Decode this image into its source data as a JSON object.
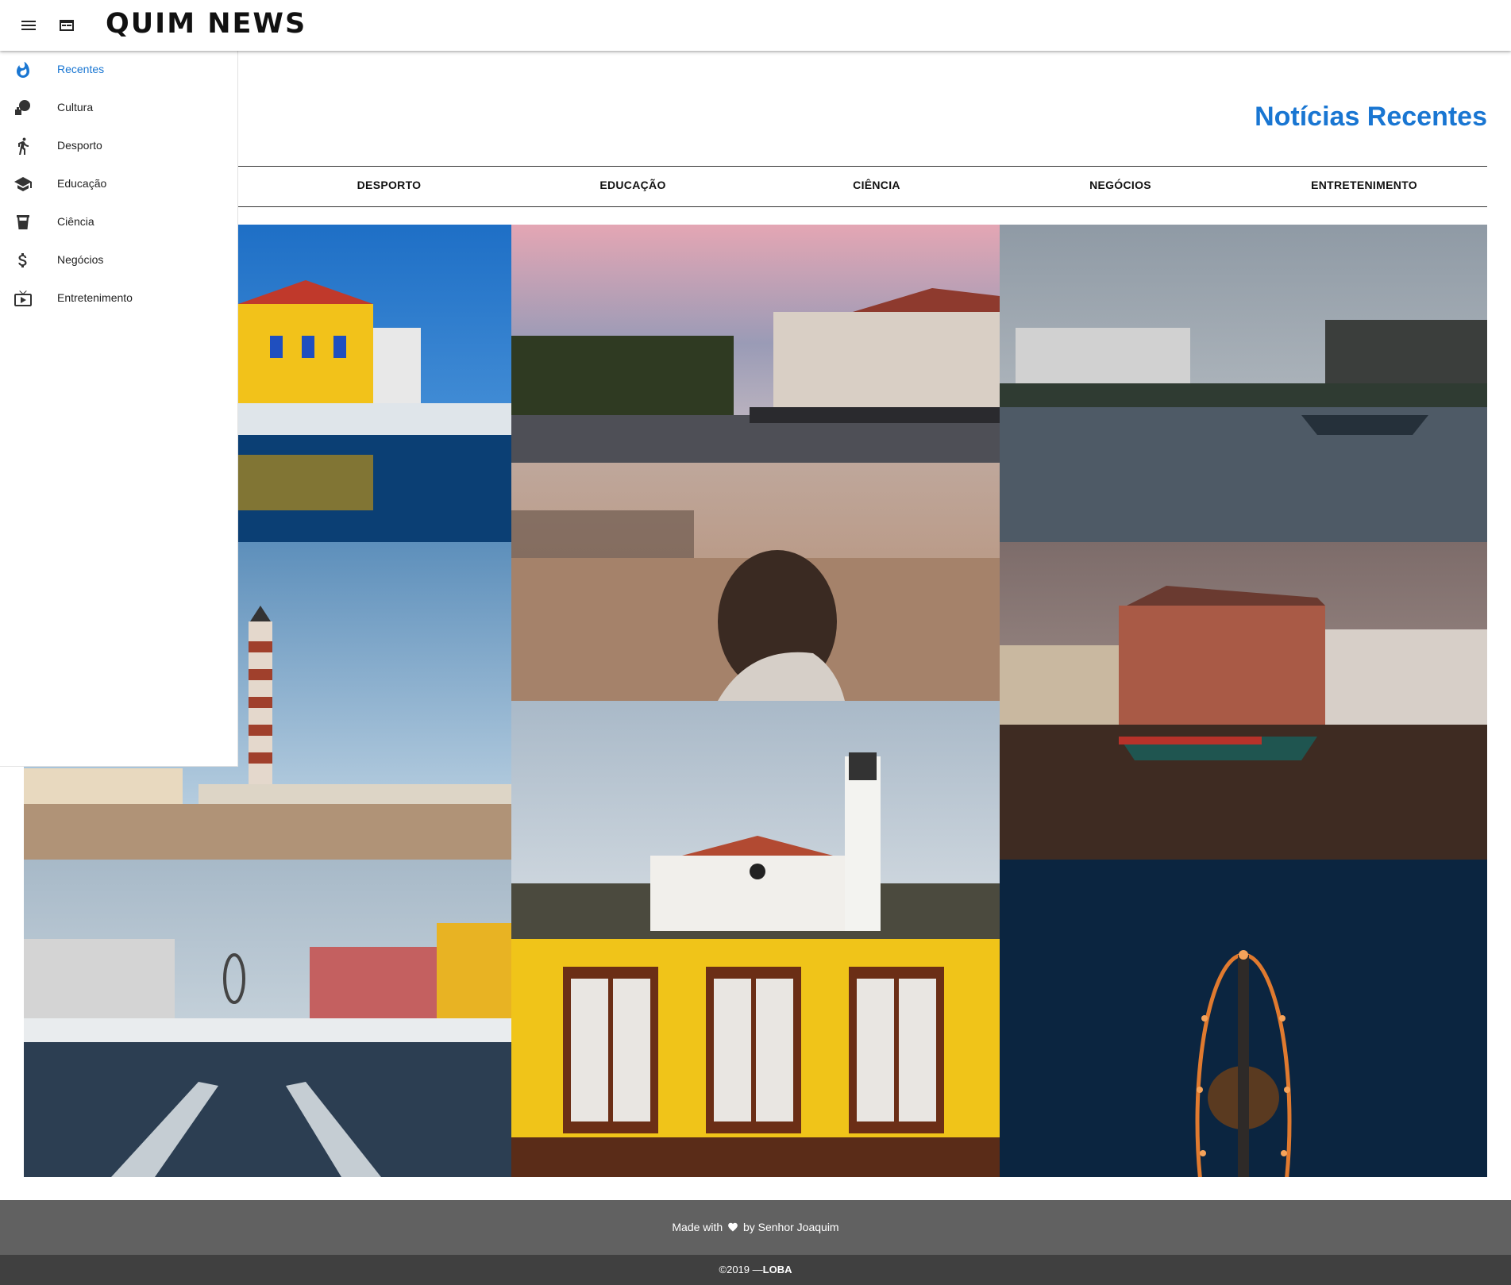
{
  "header": {
    "logo": "QUIM NEWS",
    "menu_icon": "menu-icon",
    "layout_icon": "web-layout-icon"
  },
  "sidebar": {
    "items": [
      {
        "label": "Recentes",
        "icon": "fire-icon",
        "active": true
      },
      {
        "label": "Cultura",
        "icon": "theater-icon",
        "active": false
      },
      {
        "label": "Desporto",
        "icon": "running-icon",
        "active": false
      },
      {
        "label": "Educação",
        "icon": "graduation-cap-icon",
        "active": false
      },
      {
        "label": "Ciência",
        "icon": "flask-icon",
        "active": false
      },
      {
        "label": "Negócios",
        "icon": "dollar-icon",
        "active": false
      },
      {
        "label": "Entretenimento",
        "icon": "tv-icon",
        "active": false
      }
    ]
  },
  "main": {
    "title": "Notícias Recentes",
    "tabs": [
      "DESPORTO",
      "EDUCAÇÃO",
      "CIÊNCIA",
      "NEGÓCIOS",
      "ENTRETENIMENTO"
    ]
  },
  "footer": {
    "made_prefix": "Made with",
    "made_suffix": "by Senhor Joaquim",
    "copyright_prefix": "©2019 —",
    "copyright_brand": "LOBA"
  },
  "colors": {
    "accent": "#1976d2",
    "footer_top": "#616161",
    "footer_bottom": "#404040"
  }
}
